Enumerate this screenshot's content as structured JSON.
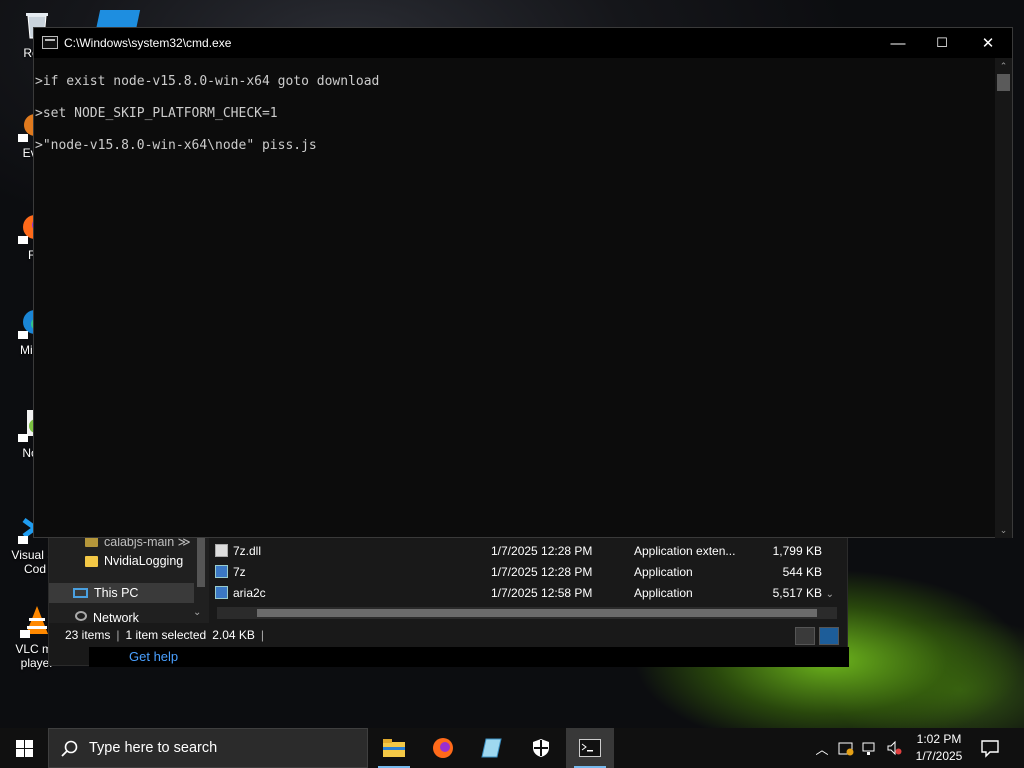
{
  "desktop": {
    "icons": [
      {
        "label": "Recy"
      },
      {
        "label": "Ever"
      },
      {
        "label": "Fir"
      },
      {
        "label": "Mic E"
      },
      {
        "label": "Note"
      },
      {
        "label": "Visual St Cod"
      },
      {
        "label": "VLC me player"
      }
    ]
  },
  "cmd": {
    "title": "C:\\Windows\\system32\\cmd.exe",
    "lines": [
      ">if exist node-v15.8.0-win-x64 goto download",
      ">set NODE_SKIP_PLATFORM_CHECK=1",
      ">\"node-v15.8.0-win-x64\\node\" piss.js"
    ],
    "minimize": "—",
    "maximize": "☐",
    "close": "✕"
  },
  "explorer": {
    "nav_items": [
      {
        "label": "calabjs-main",
        "truncated": "calabjs-main ≫"
      },
      {
        "label": "NvidiaLogging"
      },
      {
        "label": "This PC"
      },
      {
        "label": "Network"
      }
    ],
    "files": [
      {
        "name": "7z.dll",
        "date": "1/7/2025 12:28 PM",
        "type": "Application exten...",
        "size": "1,799 KB"
      },
      {
        "name": "7z",
        "date": "1/7/2025 12:28 PM",
        "type": "Application",
        "size": "544 KB"
      },
      {
        "name": "aria2c",
        "date": "1/7/2025 12:58 PM",
        "type": "Application",
        "size": "5,517 KB"
      }
    ],
    "status": {
      "count": "23 items",
      "selected": "1 item selected",
      "size": "2.04 KB"
    },
    "help": "Get help"
  },
  "taskbar": {
    "search_placeholder": "Type here to search",
    "apps": [
      {
        "name": "file-explorer"
      },
      {
        "name": "firefox"
      },
      {
        "name": "notepad"
      },
      {
        "name": "windows-security"
      },
      {
        "name": "command-prompt"
      }
    ],
    "time": "1:02 PM",
    "date": "1/7/2025"
  },
  "colors": {
    "accent": "#76b9ed",
    "cmd_text": "#cccccc",
    "link": "#4aa0ff"
  }
}
